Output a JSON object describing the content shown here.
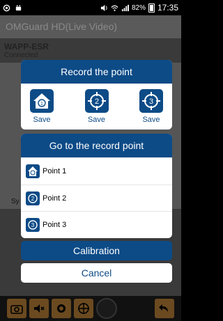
{
  "status_bar": {
    "battery": "82%",
    "time": "17:35"
  },
  "app": {
    "title": "OMGuard HD(Live Video)",
    "device_name": "WAPP-ESR",
    "connection_status": "Connected",
    "partial_label": "Sy"
  },
  "record_dialog": {
    "title": "Record the point",
    "items": [
      {
        "label": "Save",
        "icon": "home-point-1-icon"
      },
      {
        "label": "Save",
        "icon": "target-point-2-icon"
      },
      {
        "label": "Save",
        "icon": "target-point-3-icon"
      }
    ]
  },
  "goto_dialog": {
    "title": "Go to the record point",
    "points": [
      {
        "label": "Point 1"
      },
      {
        "label": "Point 2"
      },
      {
        "label": "Point 3"
      }
    ]
  },
  "buttons": {
    "calibration": "Calibration",
    "cancel": "Cancel"
  },
  "colors": {
    "accent": "#0d4b87",
    "toolbar_button": "#6b4a20"
  }
}
